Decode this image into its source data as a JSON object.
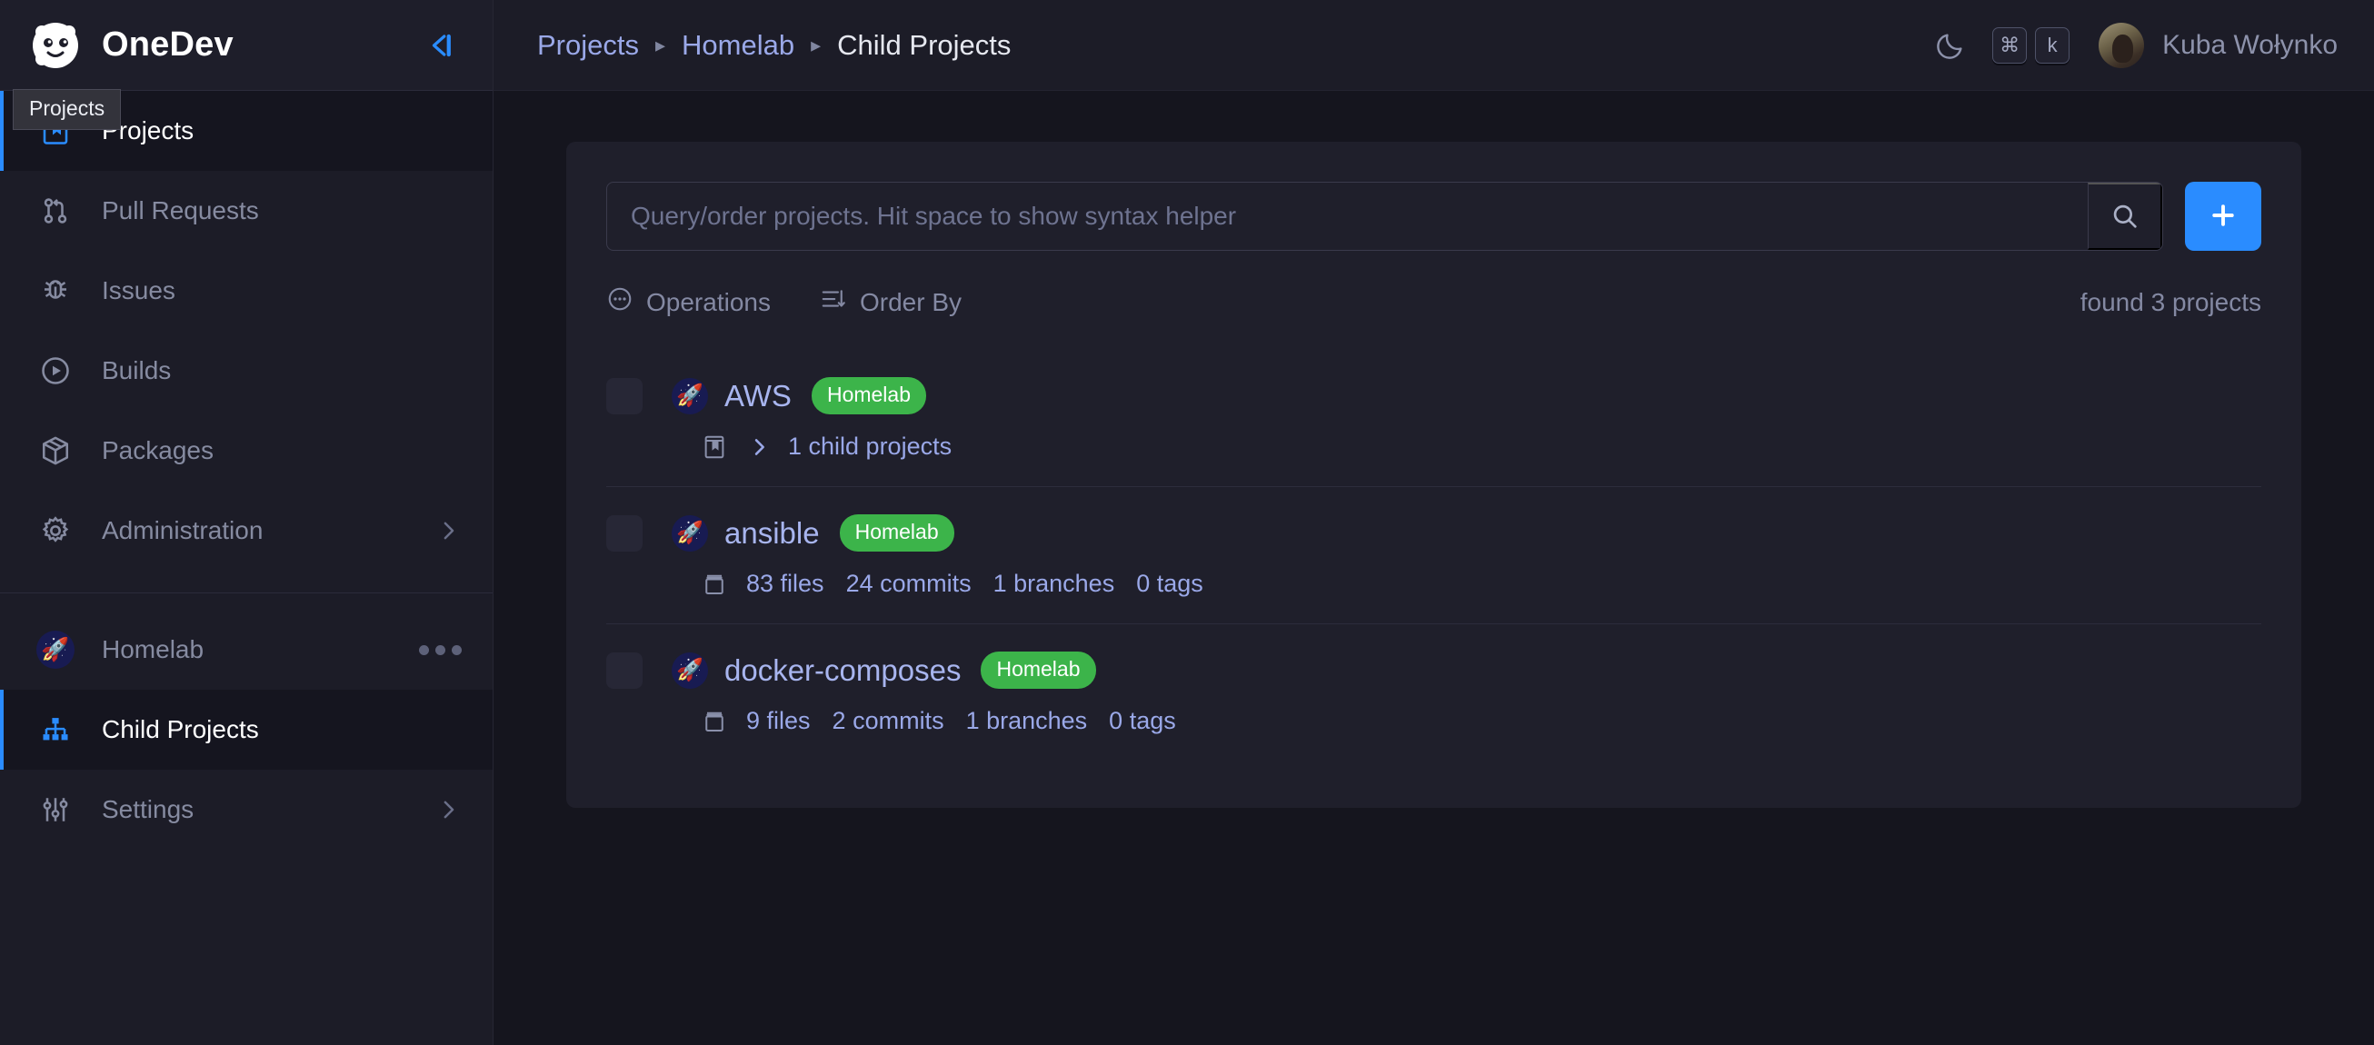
{
  "brand": {
    "name": "OneDev",
    "logo_icon": "panda-logo-icon",
    "collapse_icon": "collapse-sidebar-icon"
  },
  "tooltip": {
    "text": "Projects"
  },
  "sidebar": {
    "items": [
      {
        "label": "Projects",
        "icon": "book-bookmark-icon",
        "active": true,
        "chevron": false
      },
      {
        "label": "Pull Requests",
        "icon": "pull-request-icon",
        "active": false,
        "chevron": false
      },
      {
        "label": "Issues",
        "icon": "bug-icon",
        "active": false,
        "chevron": false
      },
      {
        "label": "Builds",
        "icon": "play-circle-icon",
        "active": false,
        "chevron": false
      },
      {
        "label": "Packages",
        "icon": "package-box-icon",
        "active": false,
        "chevron": false
      },
      {
        "label": "Administration",
        "icon": "gear-icon",
        "active": false,
        "chevron": true
      }
    ],
    "project_items": [
      {
        "label": "Homelab",
        "icon": "rocket-icon",
        "active": false,
        "menu": true
      },
      {
        "label": "Child Projects",
        "icon": "sitemap-icon",
        "active": true,
        "menu": false
      },
      {
        "label": "Settings",
        "icon": "sliders-icon",
        "active": false,
        "chevron": true
      }
    ]
  },
  "topbar": {
    "breadcrumbs": [
      {
        "label": "Projects",
        "link": true
      },
      {
        "label": "Homelab",
        "link": true
      },
      {
        "label": "Child Projects",
        "link": false
      }
    ],
    "separator": "▸",
    "theme_toggle_icon": "moon-icon",
    "shortcut_keys": [
      "⌘",
      "k"
    ],
    "user_name": "Kuba Wołynko",
    "avatar_icon": "user-avatar"
  },
  "search": {
    "value": "",
    "placeholder": "Query/order projects. Hit space to show syntax helper",
    "search_icon": "search-icon",
    "add_icon": "plus-icon"
  },
  "toolbar": {
    "operations_label": "Operations",
    "operations_icon": "circle-dots-icon",
    "order_by_label": "Order By",
    "order_by_icon": "sort-icon",
    "found_text": "found 3 projects"
  },
  "projects": [
    {
      "name": "AWS",
      "badge": "Homelab",
      "avatar_icon": "rocket-icon",
      "sub_icon": "book-bookmark-icon",
      "expand_icon": "chevron-right-icon",
      "child_text": "1 child projects",
      "stats": []
    },
    {
      "name": "ansible",
      "badge": "Homelab",
      "avatar_icon": "rocket-icon",
      "sub_icon": "archive-icon",
      "stats": [
        "83 files",
        "24 commits",
        "1 branches",
        "0 tags"
      ]
    },
    {
      "name": "docker-composes",
      "badge": "Homelab",
      "avatar_icon": "rocket-icon",
      "sub_icon": "archive-icon",
      "stats": [
        "9 files",
        "2 commits",
        "1 branches",
        "0 tags"
      ]
    }
  ],
  "colors": {
    "accent_blue": "#2a8cff",
    "badge_green": "#3cb44a",
    "link_blue": "#9aa8e8",
    "page_bg": "#15151e",
    "card_bg": "#1f1f2b",
    "sidebar_bg": "#1c1c27"
  }
}
